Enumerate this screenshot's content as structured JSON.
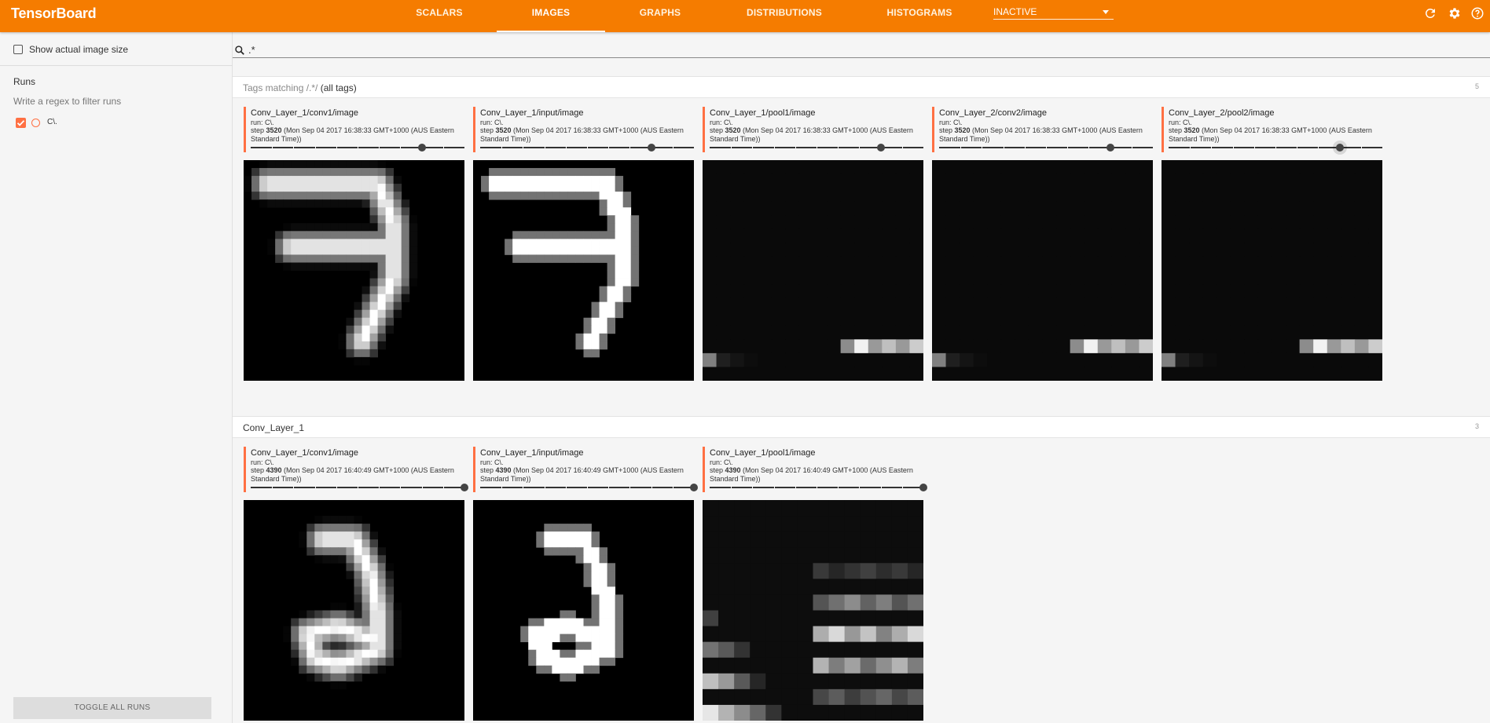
{
  "app": {
    "title": "TensorBoard"
  },
  "nav": {
    "tabs": [
      {
        "label": "SCALARS"
      },
      {
        "label": "IMAGES"
      },
      {
        "label": "GRAPHS"
      },
      {
        "label": "DISTRIBUTIONS"
      },
      {
        "label": "HISTOGRAMS"
      }
    ],
    "active_tab": "IMAGES",
    "inactive_select": {
      "value": "INACTIVE"
    },
    "icons": [
      "refresh-icon",
      "gear-icon",
      "help-icon"
    ]
  },
  "sidebar": {
    "show_actual_size_label": "Show actual image size",
    "runs_heading": "Runs",
    "filter_placeholder": "Write a regex to filter runs",
    "runs": [
      {
        "name": "C\\.",
        "checked": true,
        "color": "#ff7043"
      }
    ],
    "toggle_all_label": "TOGGLE ALL RUNS"
  },
  "search": {
    "value": ".*"
  },
  "panes": [
    {
      "title_prefix": "Tags matching /.*/",
      "title_suffix": "(all tags)",
      "count": "5",
      "cards": [
        {
          "tag": "Conv_Layer_1/conv1/image",
          "run": "run: C\\.",
          "step_label": "step",
          "step": "3520",
          "time": "(Mon Sep 04 2017 16:38:33 GMT+1000 (AUS Eastern Standard Time))",
          "slider_fraction": 0.8,
          "image_kind": "blurred-seven"
        },
        {
          "tag": "Conv_Layer_1/input/image",
          "run": "run: C\\.",
          "step_label": "step",
          "step": "3520",
          "time": "(Mon Sep 04 2017 16:38:33 GMT+1000 (AUS Eastern Standard Time))",
          "slider_fraction": 0.8,
          "image_kind": "sharp-seven"
        },
        {
          "tag": "Conv_Layer_1/pool1/image",
          "run": "run: C\\.",
          "step_label": "step",
          "step": "3520",
          "time": "(Mon Sep 04 2017 16:38:33 GMT+1000 (AUS Eastern Standard Time))",
          "slider_fraction": 0.8,
          "image_kind": "pool-dark"
        },
        {
          "tag": "Conv_Layer_2/conv2/image",
          "run": "run: C\\.",
          "step_label": "step",
          "step": "3520",
          "time": "(Mon Sep 04 2017 16:38:33 GMT+1000 (AUS Eastern Standard Time))",
          "slider_fraction": 0.8,
          "image_kind": "pool-dark"
        },
        {
          "tag": "Conv_Layer_2/pool2/image",
          "run": "run: C\\.",
          "step_label": "step",
          "step": "3520",
          "time": "(Mon Sep 04 2017 16:38:33 GMT+1000 (AUS Eastern Standard Time))",
          "slider_fraction": 0.8,
          "image_kind": "pool-dark"
        }
      ]
    },
    {
      "title_prefix": "Conv_Layer_1",
      "title_suffix": "",
      "count": "3",
      "cards": [
        {
          "tag": "Conv_Layer_1/conv1/image",
          "run": "run: C\\.",
          "step_label": "step",
          "step": "4390",
          "time": "(Mon Sep 04 2017 16:40:49 GMT+1000 (AUS Eastern Standard Time))",
          "slider_fraction": 1.0,
          "image_kind": "blurred-two"
        },
        {
          "tag": "Conv_Layer_1/input/image",
          "run": "run: C\\.",
          "step_label": "step",
          "step": "4390",
          "time": "(Mon Sep 04 2017 16:40:49 GMT+1000 (AUS Eastern Standard Time))",
          "slider_fraction": 1.0,
          "image_kind": "sharp-two"
        },
        {
          "tag": "Conv_Layer_1/pool1/image",
          "run": "run: C\\.",
          "step_label": "step",
          "step": "4390",
          "time": "(Mon Sep 04 2017 16:40:49 GMT+1000 (AUS Eastern Standard Time))",
          "slider_fraction": 1.0,
          "image_kind": "pool-stripes"
        }
      ]
    }
  ]
}
